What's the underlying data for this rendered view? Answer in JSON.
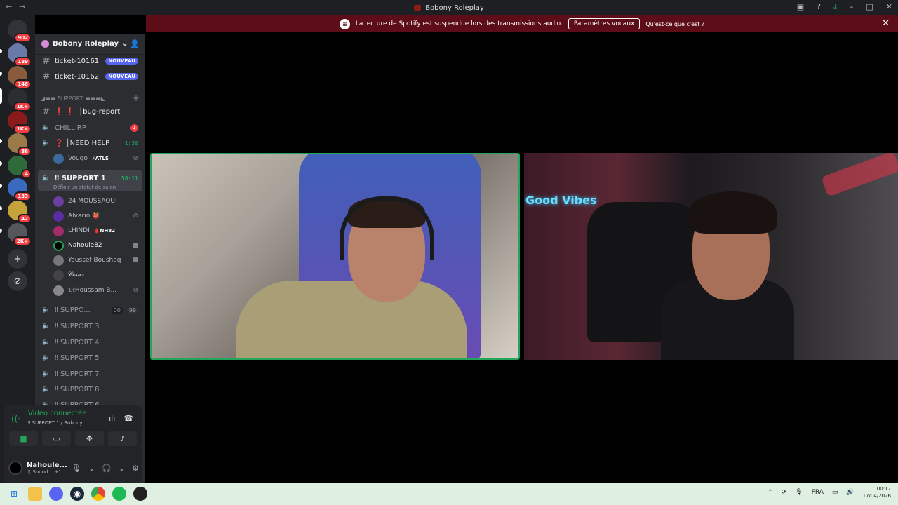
{
  "window": {
    "title": "Bobony Roleplay",
    "back": "←",
    "forward": "→"
  },
  "banner": {
    "message": "La lecture de Spotify est suspendue lors des transmissions audio.",
    "button": "Paramètres vocaux",
    "link": "Qu'est-ce que c'est ?",
    "close": "✕"
  },
  "rail": {
    "badges": [
      "902",
      "189",
      "148",
      "1K+",
      "1K+",
      "86",
      "4",
      "133",
      "42",
      "2K+"
    ],
    "add": "+",
    "explore": "⊘"
  },
  "guild": {
    "name": "Bobony Roleplay",
    "chevron": "⌄"
  },
  "channels": {
    "ticket1": {
      "name": "ticket-10161",
      "badge": "NOUVEAU"
    },
    "ticket2": {
      "name": "ticket-10162",
      "badge": "NOUVEAU"
    },
    "category": "◢▬▬ SUPPORT ▬▬▬◣",
    "bug": {
      "prefix": "❗ ❗",
      "name": "│bug-report"
    },
    "chill": {
      "name": "CHILL RP",
      "badge": "1"
    },
    "needhelp": {
      "name": "❓ │NEED HELP",
      "time": "1:30"
    },
    "needhelp_user": {
      "name": "Vougo",
      "tag": "⚡ATLS"
    },
    "support1": {
      "name": "‼ SUPPORT 1",
      "time": "56:11",
      "status": "Définir un statut de salon"
    },
    "support1_users": [
      {
        "name": "24 MOUSSAOUI"
      },
      {
        "name": "Alvario 👹"
      },
      {
        "name": "LHINDI",
        "tag": "🩸NH82"
      },
      {
        "name": "Nahoule82"
      },
      {
        "name": "Youssef Boushaq"
      },
      {
        "name": "𝓒𝓮𝓼𝓪𝓻"
      },
      {
        "name": "𝔇𝔯Houssam B..."
      }
    ],
    "support2": {
      "name": "‼ SUPPO...",
      "a": "00",
      "b": "99"
    },
    "support3": "‼ SUPPORT 3",
    "support4": "‼ SUPPORT 4",
    "support5": "‼ SUPPORT 5",
    "support7": "‼ SUPPORT 7",
    "support8": "‼ SUPPORT 8",
    "support9": "‼ SUPPORT 6"
  },
  "voice": {
    "title": "Vidéo connectée",
    "subtitle": "‼ SUPPORT 1 / Bobony ...",
    "user": {
      "name": "Nahoule...",
      "status": "♫ Sound... +1"
    }
  },
  "taskbar": {
    "lang": "FRA",
    "time": "00:17",
    "date": "17/04/2026"
  },
  "colors": {
    "green": "#23a55a",
    "banner": "#5c0d17",
    "sidebar": "#2b2d31",
    "rail": "#1e1f22"
  }
}
